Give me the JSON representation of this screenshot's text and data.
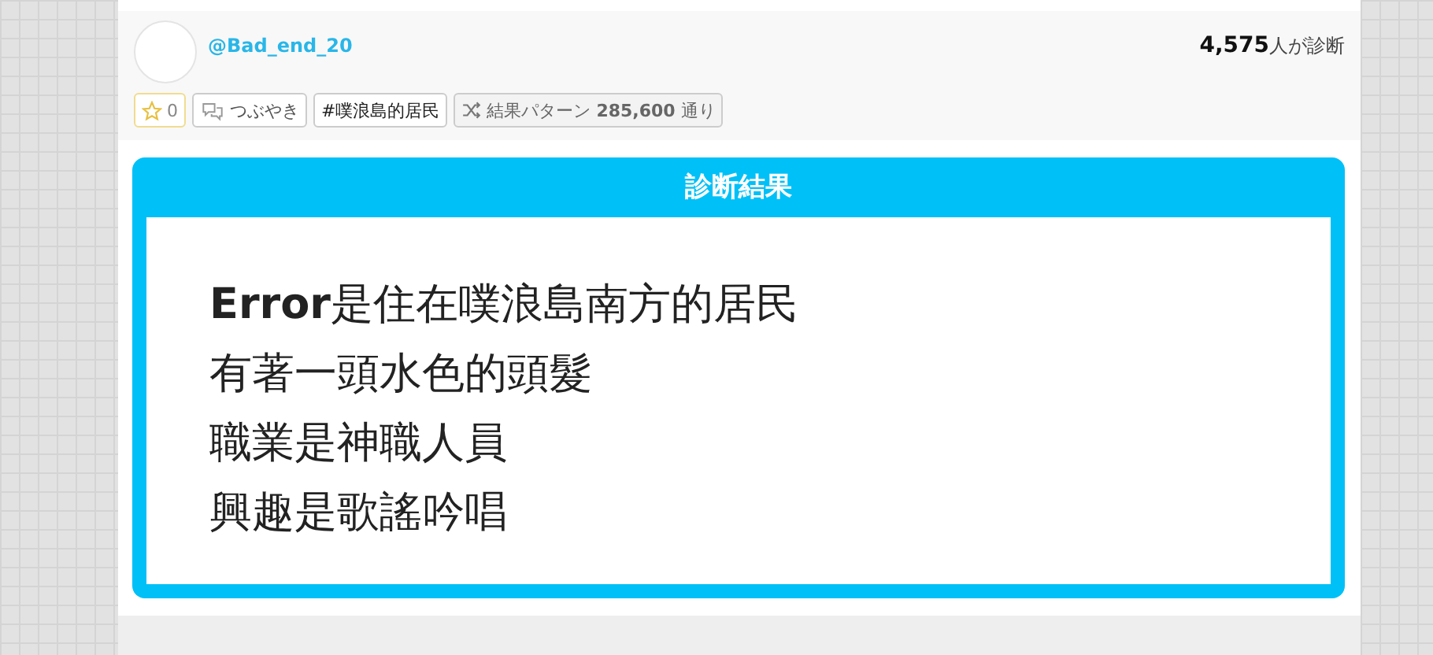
{
  "author": {
    "handle": "@Bad_end_20"
  },
  "diagnosed": {
    "count": "4,575",
    "suffix": "人が診断"
  },
  "tags": [
    {
      "kind": "star",
      "label": "0"
    },
    {
      "kind": "tweet",
      "label": "つぶやき"
    },
    {
      "kind": "hashtag",
      "label": "#噗浪島的居民"
    },
    {
      "kind": "patterns",
      "label": "結果パターン **285,600** 通り"
    }
  ],
  "result": {
    "title": "診断結果",
    "lines": [
      "**Error**是住在噗浪島南方的居民",
      "有著一頭水色的頭髮",
      "職業是神職人員",
      "興趣是歌謠吟唱"
    ]
  }
}
